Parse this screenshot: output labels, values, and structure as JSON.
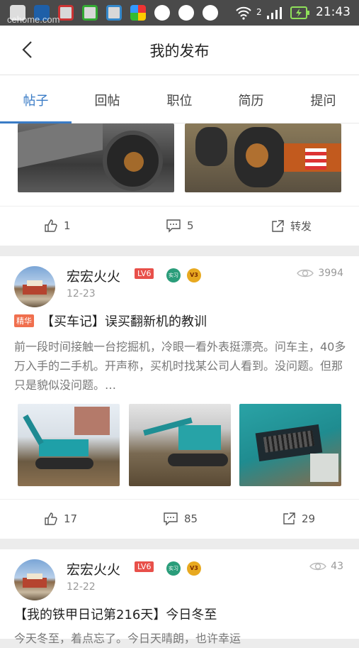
{
  "status": {
    "time": "21:43",
    "watermark": "cehome.com"
  },
  "header": {
    "title": "我的发布"
  },
  "tabs": [
    "帖子",
    "回帖",
    "职位",
    "简历",
    "提问"
  ],
  "post0": {
    "likes": "1",
    "comments": "5",
    "share": "转发"
  },
  "post1": {
    "user": "宏宏火火",
    "level": "LV6",
    "date": "12-23",
    "views": "3994",
    "tag": "精华",
    "title": "【买车记】误买翻新机的教训",
    "body": "前一段时间接触一台挖掘机，冷眼一看外表挺漂亮。问车主，40多万入手的二手机。开声称，买机时找某公司人看到。没问题。但那只是貌似没问题。…",
    "likes": "17",
    "comments": "85",
    "shares": "29",
    "badge1": "实习",
    "badge2": "V3"
  },
  "post2": {
    "user": "宏宏火火",
    "level": "LV6",
    "date": "12-22",
    "views": "43",
    "title": "【我的铁甲日记第216天】今日冬至",
    "body": "今天冬至，着点忘了。今日天晴朗，也许幸运",
    "badge1": "实习",
    "badge2": "V3"
  },
  "colors": {
    "accent": "#3a7cc6",
    "level": "#e8504a",
    "tag": "#f06f4e"
  }
}
